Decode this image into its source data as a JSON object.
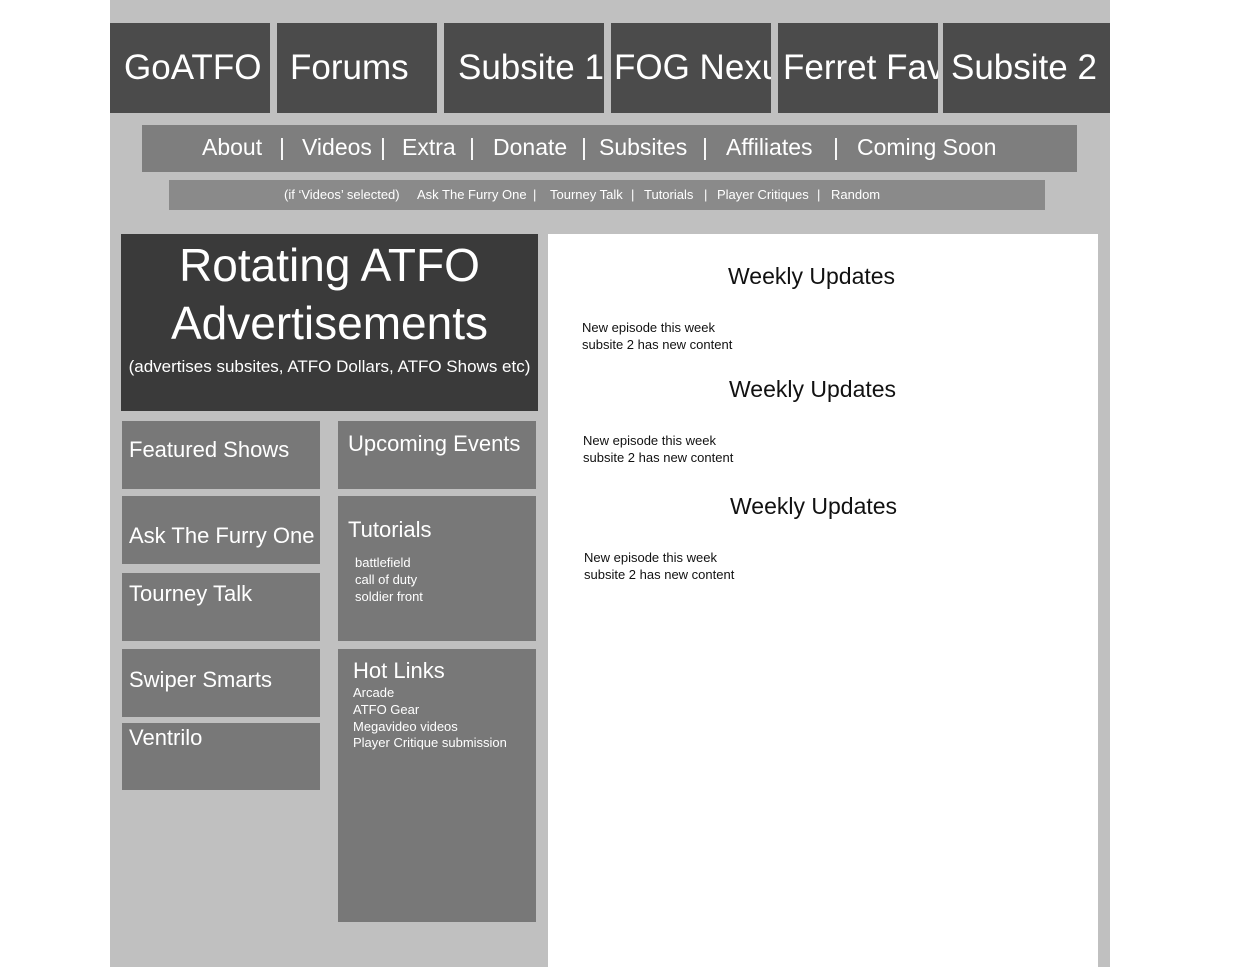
{
  "top_tabs": [
    "GoATFO",
    "Forums",
    "Subsite 1",
    "FOG Nexu",
    "Ferret Fav",
    "Subsite 2"
  ],
  "nav_items": [
    "About",
    "|",
    "Videos",
    "|",
    "Extra",
    "|",
    "Donate",
    "|",
    "Subsites",
    "|",
    "Affiliates",
    "|",
    "Coming Soon"
  ],
  "sub_nav": {
    "note": "(if ‘Videos’ selected)",
    "items": [
      "Ask The Furry One",
      "|",
      "Tourney Talk",
      "|",
      "Tutorials",
      "|",
      "Player Critiques",
      "|",
      "Random"
    ]
  },
  "ad": {
    "title_line1": "Rotating ATFO",
    "title_line2": "Advertisements",
    "subtitle": "(advertises subsites, ATFO Dollars, ATFO Shows etc)"
  },
  "left_boxes": [
    "Featured Shows",
    "Ask The Furry One",
    "Tourney Talk",
    "Swiper Smarts",
    "Ventrilo"
  ],
  "upcoming_events": {
    "title": "Upcoming Events"
  },
  "tutorials": {
    "title": "Tutorials",
    "items": [
      "battlefield",
      "call of duty",
      "soldier front"
    ]
  },
  "hot_links": {
    "title": "Hot Links",
    "items": [
      "Arcade",
      "ATFO Gear",
      "Megavideo videos",
      "Player Critique submission"
    ]
  },
  "weekly_updates": [
    {
      "title": "Weekly Updates",
      "lines": [
        "New episode this week",
        "subsite 2 has new content"
      ]
    },
    {
      "title": "Weekly Updates",
      "lines": [
        "New episode this week",
        "subsite 2 has new content"
      ]
    },
    {
      "title": "Weekly Updates",
      "lines": [
        "New episode this week",
        "subsite 2 has new content"
      ]
    }
  ]
}
